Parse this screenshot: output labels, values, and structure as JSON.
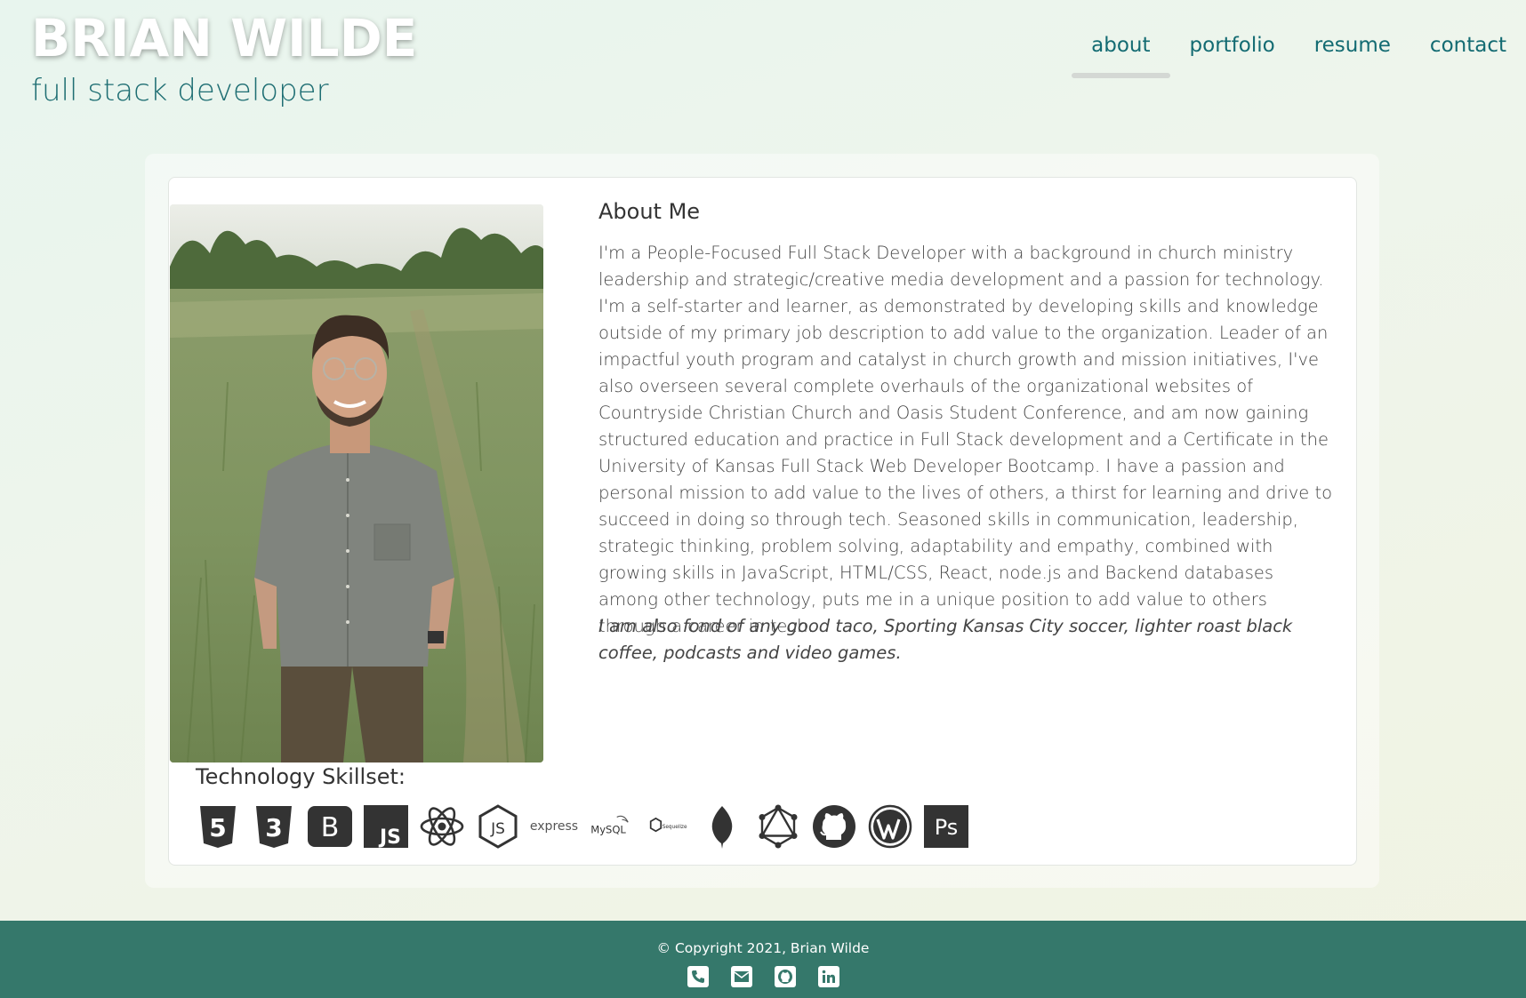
{
  "header": {
    "name": "BRIAN WILDE",
    "tagline": "full stack developer"
  },
  "nav": {
    "items": [
      {
        "label": "about",
        "active": true
      },
      {
        "label": "portfolio",
        "active": false
      },
      {
        "label": "resume",
        "active": false
      },
      {
        "label": "contact",
        "active": false
      }
    ]
  },
  "about": {
    "title": "About Me",
    "body": "I'm a People-Focused Full Stack Developer with a background in church ministry leadership and strategic/creative media development and a passion for technology. I'm a self-starter and learner, as demonstrated by developing skills and knowledge outside of my primary job description to add value to the organization. Leader of an impactful youth program and catalyst in church growth and mission initiatives, I've also overseen several complete overhauls of the organizational websites of Countryside Christian Church and Oasis Student Conference, and am now gaining structured education and practice in Full Stack development and a Certificate in the University of Kansas Full Stack Web Developer Bootcamp. I have a passion and personal mission to add value to the lives of others, a thirst for learning and drive to succeed in doing so through tech. Seasoned skills in communication, leadership, strategic thinking, problem solving, adaptability and empathy, combined with growing skills in JavaScript, HTML/CSS, React, node.js and Backend databases among other technology, puts me in a unique position to add value to others through a career in tech.",
    "fun": "I am also fond of any good taco, Sporting Kansas City soccer, lighter roast black coffee, podcasts and video games."
  },
  "skills": {
    "title": "Technology Skillset:",
    "icons": [
      {
        "name": "html5-icon",
        "label": "5"
      },
      {
        "name": "css3-icon",
        "label": "3"
      },
      {
        "name": "bootstrap-icon",
        "label": "B"
      },
      {
        "name": "javascript-icon",
        "label": "JS"
      },
      {
        "name": "react-icon"
      },
      {
        "name": "nodejs-icon",
        "label": "JS"
      },
      {
        "name": "express-icon",
        "label": "express"
      },
      {
        "name": "mysql-icon",
        "label": "MySQL"
      },
      {
        "name": "sequelize-icon",
        "label": "Sequelize"
      },
      {
        "name": "mongodb-icon"
      },
      {
        "name": "graphql-icon"
      },
      {
        "name": "github-icon"
      },
      {
        "name": "wordpress-icon"
      },
      {
        "name": "photoshop-icon",
        "label": "Ps"
      }
    ]
  },
  "footer": {
    "copyright": "© Copyright 2021, Brian Wilde",
    "icons": [
      "phone-icon",
      "email-icon",
      "github-icon",
      "linkedin-icon"
    ]
  },
  "colors": {
    "accent": "#136b72",
    "footer": "#35786b",
    "icon": "#333333"
  }
}
